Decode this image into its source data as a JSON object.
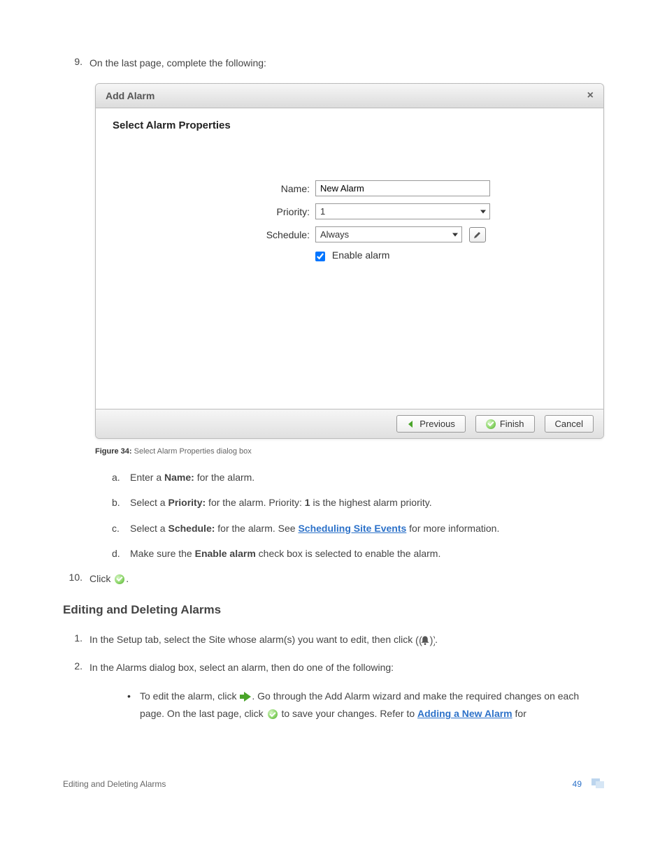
{
  "step9": {
    "number": "9.",
    "text": "On the last page, complete the following:"
  },
  "dialog": {
    "title": "Add Alarm",
    "subtitle": "Select Alarm Properties",
    "fields": {
      "name_label": "Name:",
      "name_value": "New Alarm",
      "priority_label": "Priority:",
      "priority_value": "1",
      "schedule_label": "Schedule:",
      "schedule_value": "Always",
      "enable_label": "Enable alarm"
    },
    "buttons": {
      "previous": "Previous",
      "finish": "Finish",
      "cancel": "Cancel"
    }
  },
  "figure": {
    "label": "Figure 34:",
    "caption": "Select Alarm Properties dialog box"
  },
  "substeps": {
    "a": {
      "letter": "a.",
      "pre": "Enter a ",
      "bold": "Name:",
      "post": " for the alarm."
    },
    "b": {
      "letter": "b.",
      "pre": "Select a ",
      "bold": "Priority:",
      "mid": " for the alarm. Priority: ",
      "bold2": "1",
      "post": " is the highest alarm priority."
    },
    "c": {
      "letter": "c.",
      "pre": "Select a ",
      "bold": "Schedule:",
      "mid": " for the alarm. See ",
      "link": "Scheduling Site Events",
      "post": " for more information."
    },
    "d": {
      "letter": "d.",
      "pre": "Make sure the ",
      "bold": "Enable alarm",
      "post": " check box is selected to enable the alarm."
    }
  },
  "step10": {
    "number": "10.",
    "text": "Click "
  },
  "heading": "Editing and Deleting Alarms",
  "edit1": {
    "number": "1.",
    "text": "In the Setup tab, select the Site whose alarm(s) you want to edit, then click ",
    "post": "."
  },
  "edit2": {
    "number": "2.",
    "text": "In the Alarms dialog box, select an alarm, then do one of the following:"
  },
  "bullet": {
    "pre": "To edit the alarm, click ",
    "mid": ". Go through the Add Alarm wizard and make the required changes on each page. On the last page, click ",
    "mid2": " to save your changes. Refer to ",
    "link": "Adding a New Alarm",
    "post": " for"
  },
  "footer": {
    "section": "Editing and Deleting Alarms",
    "page": "49"
  }
}
